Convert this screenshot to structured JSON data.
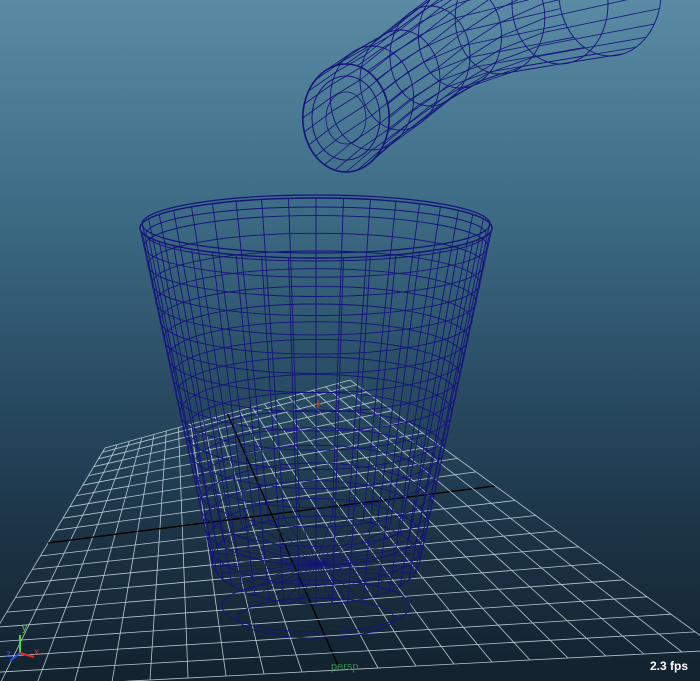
{
  "viewport": {
    "camera_label": "persp",
    "fps_label": "2.3 fps"
  },
  "axis_gizmo": {
    "x": "x",
    "y": "y",
    "z": "z"
  },
  "colors": {
    "wireframe": "#14147a",
    "grid": "#b8c8d2",
    "grid_axis": "#000000",
    "fps_text": "#ffffff",
    "camera_text": "#2f8a4a"
  },
  "objects": [
    {
      "name": "cup",
      "type": "wireframe-cylinder"
    },
    {
      "name": "tube",
      "type": "wireframe-tube"
    }
  ]
}
